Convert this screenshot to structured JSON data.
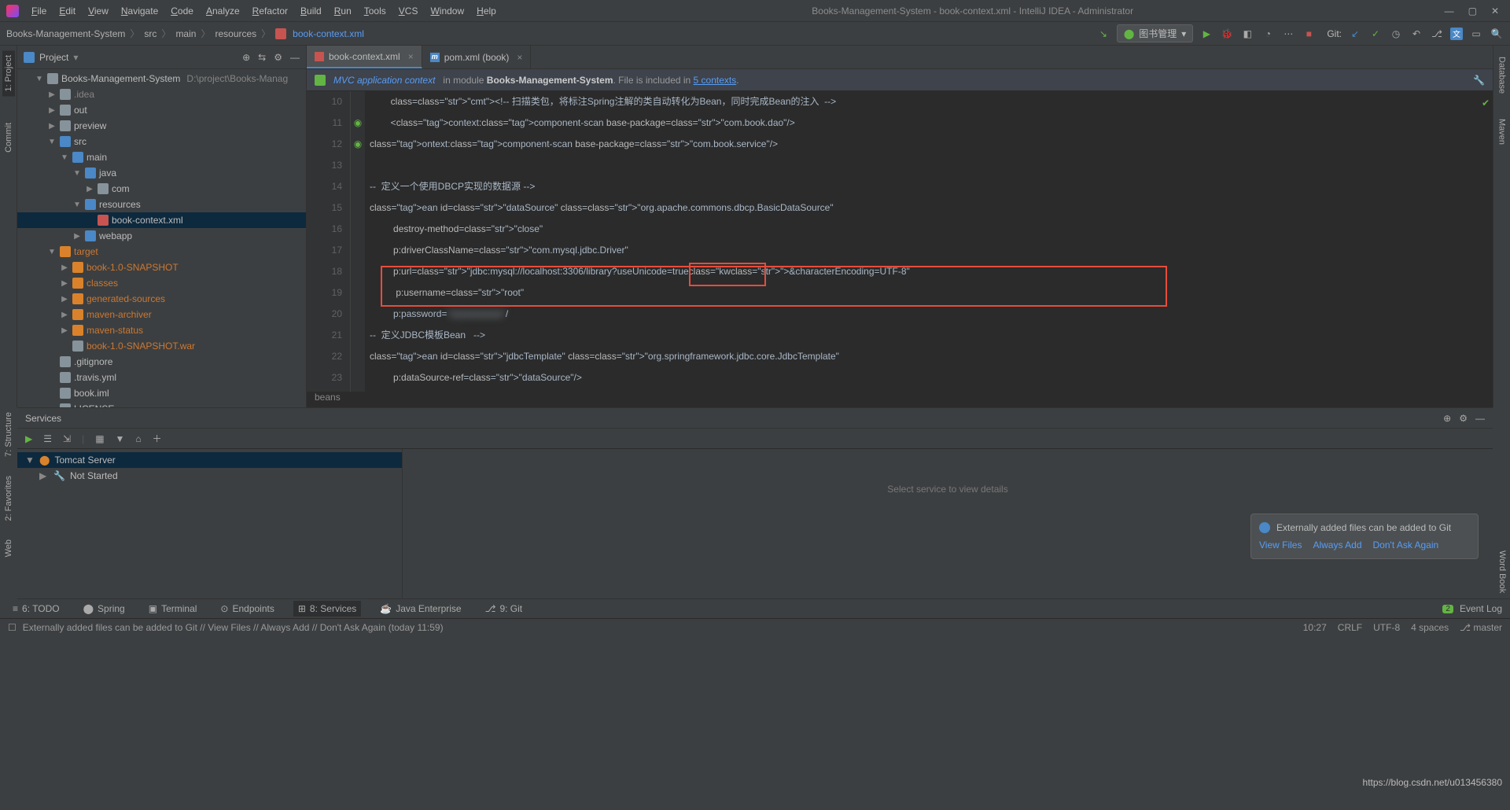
{
  "window": {
    "title": "Books-Management-System - book-context.xml - IntelliJ IDEA - Administrator"
  },
  "menu": [
    "File",
    "Edit",
    "View",
    "Navigate",
    "Code",
    "Analyze",
    "Refactor",
    "Build",
    "Run",
    "Tools",
    "VCS",
    "Window",
    "Help"
  ],
  "breadcrumb": [
    "Books-Management-System",
    "src",
    "main",
    "resources",
    "book-context.xml"
  ],
  "run_config": "图书管理",
  "git_label": "Git:",
  "project": {
    "title": "Project",
    "root": "Books-Management-System",
    "root_path": "D:\\project\\Books-Manag…",
    "tree": [
      {
        "d": 1,
        "arrow": "▼",
        "ico": "folder",
        "label": "Books-Management-System",
        "extra": "D:\\project\\Books-Manag"
      },
      {
        "d": 2,
        "arrow": "▶",
        "ico": "folder",
        "label": ".idea",
        "cls": "muted"
      },
      {
        "d": 2,
        "arrow": "▶",
        "ico": "folder",
        "label": "out"
      },
      {
        "d": 2,
        "arrow": "▶",
        "ico": "folder",
        "label": "preview"
      },
      {
        "d": 2,
        "arrow": "▼",
        "ico": "folderb",
        "label": "src"
      },
      {
        "d": 3,
        "arrow": "▼",
        "ico": "folderb",
        "label": "main"
      },
      {
        "d": 4,
        "arrow": "▼",
        "ico": "folderb",
        "label": "java"
      },
      {
        "d": 5,
        "arrow": "▶",
        "ico": "folder",
        "label": "com"
      },
      {
        "d": 4,
        "arrow": "▼",
        "ico": "folderb",
        "label": "resources"
      },
      {
        "d": 5,
        "arrow": "",
        "ico": "xml",
        "label": "book-context.xml",
        "sel": true
      },
      {
        "d": 4,
        "arrow": "▶",
        "ico": "folderb",
        "label": "webapp"
      },
      {
        "d": 2,
        "arrow": "▼",
        "ico": "foldero",
        "label": "target",
        "cls": "orange"
      },
      {
        "d": 3,
        "arrow": "▶",
        "ico": "foldero",
        "label": "book-1.0-SNAPSHOT",
        "cls": "orange"
      },
      {
        "d": 3,
        "arrow": "▶",
        "ico": "foldero",
        "label": "classes",
        "cls": "orange"
      },
      {
        "d": 3,
        "arrow": "▶",
        "ico": "foldero",
        "label": "generated-sources",
        "cls": "orange"
      },
      {
        "d": 3,
        "arrow": "▶",
        "ico": "foldero",
        "label": "maven-archiver",
        "cls": "orange"
      },
      {
        "d": 3,
        "arrow": "▶",
        "ico": "foldero",
        "label": "maven-status",
        "cls": "orange"
      },
      {
        "d": 3,
        "arrow": "",
        "ico": "file",
        "label": "book-1.0-SNAPSHOT.war",
        "cls": "orange"
      },
      {
        "d": 2,
        "arrow": "",
        "ico": "file",
        "label": ".gitignore"
      },
      {
        "d": 2,
        "arrow": "",
        "ico": "file",
        "label": ".travis.yml"
      },
      {
        "d": 2,
        "arrow": "",
        "ico": "file",
        "label": "book.iml"
      },
      {
        "d": 2,
        "arrow": "",
        "ico": "file",
        "label": "LICENSE"
      }
    ]
  },
  "tabs": [
    {
      "ico": "xml",
      "label": "book-context.xml",
      "active": true
    },
    {
      "ico": "file",
      "label": "pom.xml (book)",
      "m": true
    }
  ],
  "banner": {
    "link1": "MVC application context",
    "mid": "in module ",
    "mod": "Books-Management-System",
    "rest": ". File is included in ",
    "ctx": "5 contexts",
    "dot": "."
  },
  "code": {
    "start": 10,
    "lines": [
      "        <!-- 扫描类包，将标注Spring注解的类自动转化为Bean，同时完成Bean的注入  -->",
      "        <context:component-scan base-package=\"com.book.dao\"/>",
      "ontext:component-scan base-package=\"com.book.service\"/>",
      "",
      "--  定义一个使用DBCP实现的数据源 -->",
      "ean id=\"dataSource\" class=\"org.apache.commons.dbcp.BasicDataSource\"",
      "         destroy-method=\"close\"",
      "         p:driverClassName=\"com.mysql.jdbc.Driver\"",
      "         p:url=\"jdbc:mysql://localhost:3306/library?useUnicode=true&amp;characterEncoding=UTF-8\" ",
      "          p:username=\"root\"",
      "         p:password=\"xxxxxxxx\"/",
      "--  定义JDBC模板Bean   -->",
      "ean id=\"jdbcTemplate\" class=\"org.springframework.jdbc.core.JdbcTemplate\"",
      "         p:dataSource-ref=\"dataSource\"/>"
    ],
    "crumb": "beans"
  },
  "left_tabs": [
    "1: Project",
    "Commit"
  ],
  "left_tabs2": [
    "7: Structure",
    "2: Favorites",
    "Web"
  ],
  "right_tabs": [
    "Database",
    "Maven",
    "Word Book"
  ],
  "services": {
    "title": "Services",
    "tree": [
      {
        "d": 0,
        "arrow": "▼",
        "ico": "run",
        "label": "Tomcat Server",
        "sel": true
      },
      {
        "d": 1,
        "arrow": "▶",
        "ico": "wrench",
        "label": "Not Started"
      }
    ],
    "placeholder": "Select service to view details"
  },
  "notif": {
    "msg": "Externally added files can be added to Git",
    "actions": [
      "View Files",
      "Always Add",
      "Don't Ask Again"
    ]
  },
  "bottom_tabs": [
    "6: TODO",
    "Spring",
    "Terminal",
    "Endpoints",
    "8: Services",
    "Java Enterprise",
    "9: Git"
  ],
  "bottom_active": 4,
  "event_log": "Event Log",
  "status": {
    "msg": "Externally added files can be added to Git // View Files // Always Add // Don't Ask Again (today 11:59)",
    "right": [
      "10:27",
      "CRLF",
      "UTF-8",
      "4 spaces",
      "⎇ master"
    ],
    "watermark": "https://blog.csdn.net/u013456380"
  }
}
